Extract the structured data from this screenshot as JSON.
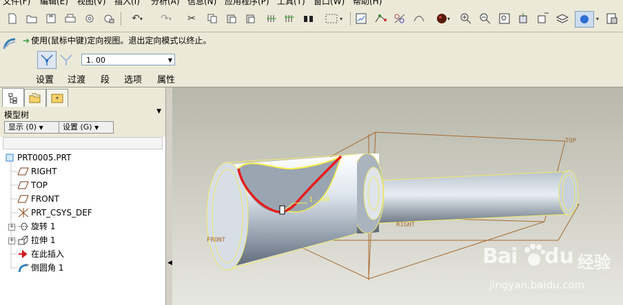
{
  "menu": [
    "文件(F)",
    "编辑(E)",
    "视图(V)",
    "插入(I)",
    "分析(A)",
    "信息(N)",
    "应用程序(P)",
    "工具(T)",
    "窗口(W)",
    "帮助(H)"
  ],
  "toolbar": {
    "icons": [
      "new-file-icon",
      "open-folder-icon",
      "save-icon",
      "print-icon",
      "email-icon",
      "undo-icon",
      "redo-icon",
      "cut-icon",
      "copy-icon",
      "paste-icon",
      "paste-special-icon",
      "regenerate-icon",
      "find-icon",
      "select-box-icon",
      "edit-definition-icon",
      "datum-icon",
      "model-tree-icon",
      "sketch-icon",
      "appearance-icon",
      "zoom-in-icon",
      "zoom-out-icon",
      "refit-icon",
      "orient-icon",
      "view-manager-icon",
      "layers-icon",
      "display-style-icon",
      "saved-views-icon"
    ]
  },
  "dashboard": {
    "message": "使用(鼠标中键)定向视图。退出定向模式以终止。",
    "radius_value": "1. 00",
    "tabs": [
      "设置",
      "过渡",
      "段",
      "选项",
      "属性"
    ]
  },
  "panel": {
    "tabs": [
      "model-tree-tab",
      "folder-browser-tab",
      "favorites-tab"
    ],
    "title": "模型树",
    "show_button": "显示 (0)",
    "settings_button": "设置 (G)"
  },
  "tree": [
    {
      "label": "PRT0005.PRT",
      "icon": "part-icon",
      "level": 0,
      "expandable": false
    },
    {
      "label": "RIGHT",
      "icon": "datum-plane-icon",
      "level": 1,
      "expandable": false
    },
    {
      "label": "TOP",
      "icon": "datum-plane-icon",
      "level": 1,
      "expandable": false
    },
    {
      "label": "FRONT",
      "icon": "datum-plane-icon",
      "level": 1,
      "expandable": false
    },
    {
      "label": "PRT_CSYS_DEF",
      "icon": "csys-icon",
      "level": 1,
      "expandable": false
    },
    {
      "label": "旋转 1",
      "icon": "revolve-icon",
      "level": 1,
      "expandable": true
    },
    {
      "label": "拉伸 1",
      "icon": "extrude-icon",
      "level": 1,
      "expandable": true
    },
    {
      "label": "在此插入",
      "icon": "insert-here-icon",
      "level": 1,
      "expandable": false
    },
    {
      "label": "倒圆角 1",
      "icon": "round-icon",
      "level": 1,
      "expandable": false
    }
  ],
  "viewport": {
    "datum_labels": {
      "top": "TOP",
      "right": "RIGHT",
      "front": "FRONT"
    },
    "dim_label": "1. 00"
  },
  "watermark": {
    "brand": "Bai",
    "cn": "经验",
    "url": "jingyan.baidu.com"
  },
  "colors": {
    "viewport_bg": "#b3b3a6",
    "datum": "#a86a2e",
    "highlight": "#e61d1d",
    "edge": "#f7f04a"
  }
}
